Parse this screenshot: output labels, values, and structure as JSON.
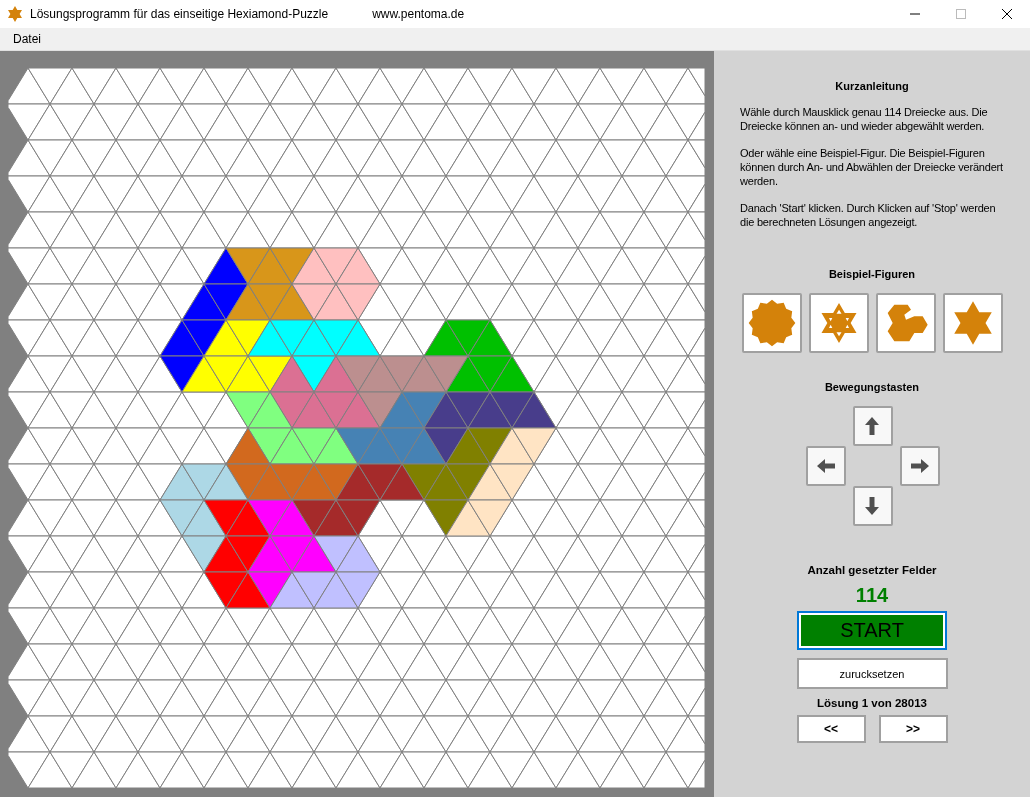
{
  "window": {
    "title": "Lösungsprogramm für das einseitige Hexiamond-Puzzle",
    "url": "www.pentoma.de"
  },
  "menu": [
    {
      "label": "Datei"
    }
  ],
  "board": {
    "rows": [
      {
        "cells": [
          null,
          null,
          null,
          null,
          null,
          null,
          null,
          null,
          null,
          null,
          null,
          null,
          null,
          null,
          null,
          null,
          null,
          null,
          null,
          null,
          null,
          null,
          null,
          null,
          null,
          null,
          null,
          null,
          null,
          null,
          null,
          null
        ]
      },
      {
        "cells": [
          null,
          null,
          null,
          null,
          null,
          null,
          null,
          null,
          null,
          null,
          null,
          null,
          null,
          null,
          null,
          null,
          null,
          null,
          null,
          null,
          null,
          null,
          null,
          null,
          null,
          null,
          null,
          null,
          null,
          null,
          null,
          null
        ]
      },
      {
        "cells": [
          null,
          null,
          null,
          null,
          null,
          null,
          null,
          null,
          null,
          null,
          null,
          null,
          null,
          null,
          null,
          null,
          null,
          null,
          null,
          null,
          null,
          null,
          null,
          null,
          null,
          null,
          null,
          null,
          null,
          null,
          null,
          null
        ]
      },
      {
        "cells": [
          null,
          null,
          null,
          null,
          null,
          null,
          null,
          null,
          null,
          null,
          null,
          null,
          null,
          null,
          null,
          null,
          null,
          null,
          null,
          null,
          null,
          null,
          null,
          null,
          null,
          null,
          null,
          null,
          null,
          null,
          null,
          null
        ]
      },
      {
        "cells": [
          null,
          null,
          null,
          null,
          null,
          null,
          null,
          null,
          null,
          null,
          null,
          null,
          null,
          null,
          null,
          null,
          null,
          null,
          null,
          null,
          null,
          null,
          null,
          null,
          null,
          null,
          null,
          null,
          null,
          null,
          null,
          null
        ]
      },
      {
        "cells": [
          null,
          null,
          null,
          null,
          null,
          null,
          null,
          null,
          null,
          {
            "color": "#0000ff"
          },
          {
            "color": "#d8961a"
          },
          {
            "color": "#d8961a"
          },
          {
            "color": "#d8961a"
          },
          {
            "color": "#ffc0c0"
          },
          {
            "color": "#ffc0c0"
          },
          {
            "color": "#ffc0c0"
          },
          null,
          null,
          null,
          null,
          null,
          null,
          null,
          null,
          null,
          null,
          null,
          null,
          null,
          null,
          null,
          null
        ]
      },
      {
        "cells": [
          null,
          null,
          null,
          null,
          null,
          null,
          null,
          null,
          {
            "color": "#0000ff"
          },
          {
            "color": "#0000ff"
          },
          {
            "color": "#d8961a"
          },
          {
            "color": "#d8961a"
          },
          {
            "color": "#d8961a"
          },
          {
            "color": "#ffc0c0"
          },
          {
            "color": "#ffc0c0"
          },
          {
            "color": "#ffc0c0"
          },
          null,
          null,
          null,
          null,
          null,
          null,
          null,
          null,
          null,
          null,
          null,
          null,
          null,
          null,
          null,
          null
        ]
      },
      {
        "cells": [
          null,
          null,
          null,
          null,
          null,
          null,
          null,
          {
            "color": "#0000ff"
          },
          {
            "color": "#0000ff"
          },
          {
            "color": "#ffff00"
          },
          {
            "color": "#ffff00"
          },
          {
            "color": "#00ffff"
          },
          {
            "color": "#00ffff"
          },
          {
            "color": "#00ffff"
          },
          {
            "color": "#00ffff"
          },
          {
            "color": "#00ffff"
          },
          null,
          null,
          null,
          {
            "color": "#00c000"
          },
          {
            "color": "#00c000"
          },
          {
            "color": "#00c000"
          },
          null,
          null,
          null,
          null,
          null,
          null,
          null,
          null,
          null,
          null
        ]
      },
      {
        "cells": [
          null,
          null,
          null,
          null,
          null,
          null,
          null,
          {
            "color": "#0000ff"
          },
          {
            "color": "#ffff00"
          },
          {
            "color": "#ffff00"
          },
          {
            "color": "#ffff00"
          },
          {
            "color": "#ffff00"
          },
          {
            "color": "#db7093"
          },
          {
            "color": "#00ffff"
          },
          {
            "color": "#db7093"
          },
          {
            "color": "#bc8f8f"
          },
          {
            "color": "#bc8f8f"
          },
          {
            "color": "#bc8f8f"
          },
          {
            "color": "#bc8f8f"
          },
          {
            "color": "#bc8f8f"
          },
          {
            "color": "#00c000"
          },
          {
            "color": "#00c000"
          },
          {
            "color": "#00c000"
          },
          null,
          null,
          null,
          null,
          null,
          null,
          null,
          null,
          null
        ]
      },
      {
        "cells": [
          null,
          null,
          null,
          null,
          null,
          null,
          null,
          null,
          null,
          null,
          {
            "color": "#80ff80"
          },
          {
            "color": "#80ff80"
          },
          {
            "color": "#db7093"
          },
          {
            "color": "#db7093"
          },
          {
            "color": "#db7093"
          },
          {
            "color": "#db7093"
          },
          {
            "color": "#bc8f8f"
          },
          {
            "color": "#4682b4"
          },
          {
            "color": "#4682b4"
          },
          {
            "color": "#483d8b"
          },
          {
            "color": "#483d8b"
          },
          {
            "color": "#483d8b"
          },
          {
            "color": "#483d8b"
          },
          {
            "color": "#483d8b"
          },
          null,
          null,
          null,
          null,
          null,
          null,
          null,
          null
        ]
      },
      {
        "cells": [
          null,
          null,
          null,
          null,
          null,
          null,
          null,
          null,
          null,
          null,
          {
            "color": "#d2691e"
          },
          {
            "color": "#80ff80"
          },
          {
            "color": "#80ff80"
          },
          {
            "color": "#80ff80"
          },
          {
            "color": "#80ff80"
          },
          {
            "color": "#4682b4"
          },
          {
            "color": "#4682b4"
          },
          {
            "color": "#4682b4"
          },
          {
            "color": "#4682b4"
          },
          {
            "color": "#483d8b"
          },
          {
            "color": "#808000"
          },
          {
            "color": "#808000"
          },
          {
            "color": "#ffe4c4"
          },
          {
            "color": "#ffe4c4"
          },
          null,
          null,
          null,
          null,
          null,
          null,
          null,
          null
        ]
      },
      {
        "cells": [
          null,
          null,
          null,
          null,
          null,
          null,
          null,
          {
            "color": "#add8e6"
          },
          {
            "color": "#add8e6"
          },
          {
            "color": "#add8e6"
          },
          {
            "color": "#d2691e"
          },
          {
            "color": "#d2691e"
          },
          {
            "color": "#d2691e"
          },
          {
            "color": "#d2691e"
          },
          {
            "color": "#d2691e"
          },
          {
            "color": "#a52a2a"
          },
          {
            "color": "#a52a2a"
          },
          {
            "color": "#a52a2a"
          },
          {
            "color": "#808000"
          },
          {
            "color": "#808000"
          },
          {
            "color": "#808000"
          },
          {
            "color": "#ffe4c4"
          },
          {
            "color": "#ffe4c4"
          },
          null,
          null,
          null,
          null,
          null,
          null,
          null,
          null,
          null
        ]
      },
      {
        "cells": [
          null,
          null,
          null,
          null,
          null,
          null,
          null,
          {
            "color": "#add8e6"
          },
          {
            "color": "#add8e6"
          },
          {
            "color": "#ff0000"
          },
          {
            "color": "#ff0000"
          },
          {
            "color": "#ff00ff"
          },
          {
            "color": "#ff00ff"
          },
          {
            "color": "#a52a2a"
          },
          {
            "color": "#a52a2a"
          },
          {
            "color": "#a52a2a"
          },
          null,
          null,
          null,
          {
            "color": "#808000"
          },
          {
            "color": "#ffe4c4"
          },
          {
            "color": "#ffe4c4"
          },
          null,
          null,
          null,
          null,
          null,
          null,
          null,
          null,
          null,
          null
        ]
      },
      {
        "cells": [
          null,
          null,
          null,
          null,
          null,
          null,
          null,
          null,
          {
            "color": "#add8e6"
          },
          {
            "color": "#ff0000"
          },
          {
            "color": "#ff0000"
          },
          {
            "color": "#ff00ff"
          },
          {
            "color": "#ff00ff"
          },
          {
            "color": "#ff00ff"
          },
          {
            "color": "#c0c0ff"
          },
          {
            "color": "#c0c0ff"
          },
          null,
          null,
          null,
          null,
          null,
          null,
          null,
          null,
          null,
          null,
          null,
          null,
          null,
          null,
          null,
          null
        ]
      },
      {
        "cells": [
          null,
          null,
          null,
          null,
          null,
          null,
          null,
          null,
          null,
          {
            "color": "#ff0000"
          },
          {
            "color": "#ff0000"
          },
          {
            "color": "#ff00ff"
          },
          {
            "color": "#c0c0ff"
          },
          {
            "color": "#c0c0ff"
          },
          {
            "color": "#c0c0ff"
          },
          {
            "color": "#c0c0ff"
          },
          null,
          null,
          null,
          null,
          null,
          null,
          null,
          null,
          null,
          null,
          null,
          null,
          null,
          null,
          null,
          null
        ]
      },
      {
        "cells": [
          null,
          null,
          null,
          null,
          null,
          null,
          null,
          null,
          null,
          null,
          null,
          null,
          null,
          null,
          null,
          null,
          null,
          null,
          null,
          null,
          null,
          null,
          null,
          null,
          null,
          null,
          null,
          null,
          null,
          null,
          null,
          null
        ]
      },
      {
        "cells": [
          null,
          null,
          null,
          null,
          null,
          null,
          null,
          null,
          null,
          null,
          null,
          null,
          null,
          null,
          null,
          null,
          null,
          null,
          null,
          null,
          null,
          null,
          null,
          null,
          null,
          null,
          null,
          null,
          null,
          null,
          null,
          null
        ]
      },
      {
        "cells": [
          null,
          null,
          null,
          null,
          null,
          null,
          null,
          null,
          null,
          null,
          null,
          null,
          null,
          null,
          null,
          null,
          null,
          null,
          null,
          null,
          null,
          null,
          null,
          null,
          null,
          null,
          null,
          null,
          null,
          null,
          null,
          null
        ]
      },
      {
        "cells": [
          null,
          null,
          null,
          null,
          null,
          null,
          null,
          null,
          null,
          null,
          null,
          null,
          null,
          null,
          null,
          null,
          null,
          null,
          null,
          null,
          null,
          null,
          null,
          null,
          null,
          null,
          null,
          null,
          null,
          null,
          null,
          null
        ]
      },
      {
        "cells": [
          null,
          null,
          null,
          null,
          null,
          null,
          null,
          null,
          null,
          null,
          null,
          null,
          null,
          null,
          null,
          null,
          null,
          null,
          null,
          null,
          null,
          null,
          null,
          null,
          null,
          null,
          null,
          null,
          null,
          null,
          null,
          null
        ]
      }
    ]
  },
  "instructions": {
    "title": "Kurzanleitung",
    "paragraphs": [
      "Wähle durch Mausklick genau 114 Dreiecke aus. Die Dreiecke können an- und wieder abgewählt werden.",
      "Oder wähle eine Beispiel-Figur. Die Beispiel-Figuren können durch An- und Abwählen der Dreiecke verändert werden.",
      "Danach 'Start' klicken. Durch Klicken auf 'Stop' werden die berechneten Lösungen angezeigt."
    ]
  },
  "examples": {
    "title": "Beispiel-Figuren",
    "figures": [
      {
        "kind": "flower"
      },
      {
        "kind": "star-holes"
      },
      {
        "kind": "trefoil"
      },
      {
        "kind": "star"
      }
    ]
  },
  "movement": {
    "title": "Bewegungstasten",
    "keys": [
      {
        "kind": "up"
      },
      {
        "kind": "left"
      },
      {
        "kind": "right"
      },
      {
        "kind": "down"
      }
    ]
  },
  "count": {
    "label": "Anzahl gesetzter Felder",
    "value": "114"
  },
  "start_button": {
    "label": "START",
    "focused": true
  },
  "reset_button": {
    "label": "zurucksetzen"
  },
  "solution": "Lösung 1 von 28013",
  "nav": [
    {
      "label": "<<"
    },
    {
      "label": ">>"
    }
  ]
}
